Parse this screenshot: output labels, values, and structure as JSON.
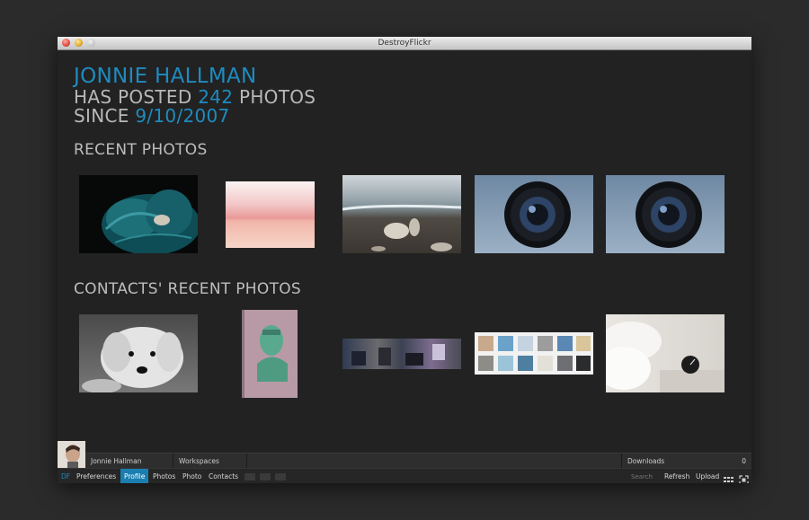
{
  "window": {
    "title": "DestroyFlickr"
  },
  "profile": {
    "name": "JONNIE HALLMAN",
    "posted_prefix": "HAS POSTED",
    "photo_count": "242",
    "posted_suffix": "PHOTOS",
    "since_prefix": "SINCE",
    "since_date": "9/10/2007"
  },
  "sections": {
    "recent": "RECENT PHOTOS",
    "contacts": "CONTACTS' RECENT PHOTOS"
  },
  "bottom": {
    "user_name": "Jonnie Hallman",
    "workspaces": "Workspaces",
    "downloads_label": "Downloads",
    "downloads_count": "0",
    "df": "DF",
    "nav": [
      "Preferences",
      "Profile",
      "Photos",
      "Photo",
      "Contacts"
    ],
    "search_placeholder": "Search",
    "refresh": "Refresh",
    "upload": "Upload"
  },
  "colors": {
    "accent": "#1f8bbf",
    "active_tab": "#1a7fb0"
  }
}
